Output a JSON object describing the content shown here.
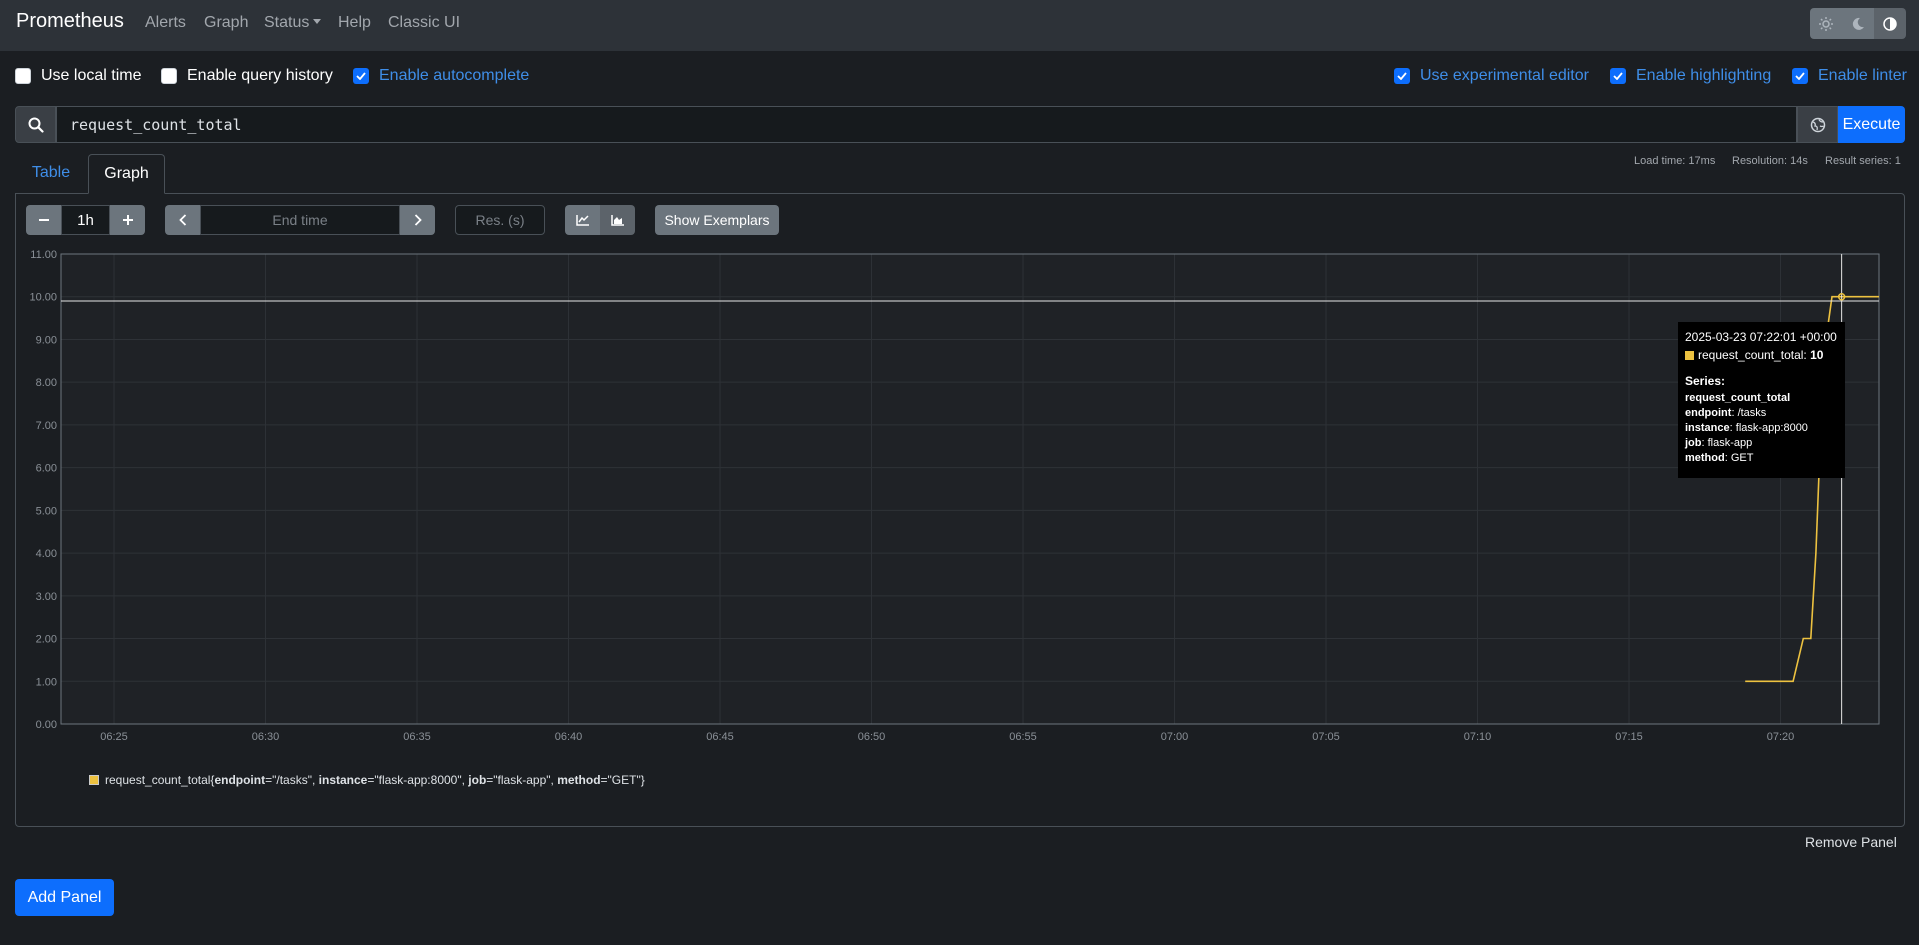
{
  "navbar": {
    "brand": "Prometheus",
    "links": [
      "Alerts",
      "Graph",
      "Status",
      "Help",
      "Classic UI"
    ],
    "theme_icons": [
      "sun-icon",
      "moon-icon",
      "adjust-icon"
    ]
  },
  "options": {
    "left": [
      {
        "label": "Use local time",
        "checked": false
      },
      {
        "label": "Enable query history",
        "checked": false
      },
      {
        "label": "Enable autocomplete",
        "checked": true
      }
    ],
    "right": [
      {
        "label": "Use experimental editor",
        "checked": true
      },
      {
        "label": "Enable highlighting",
        "checked": true
      },
      {
        "label": "Enable linter",
        "checked": true
      }
    ]
  },
  "query": {
    "expression": "request_count_total",
    "execute_label": "Execute"
  },
  "tabs": [
    "Table",
    "Graph"
  ],
  "stats": {
    "load_time": "Load time: 17ms",
    "resolution": "Resolution: 14s",
    "result_series": "Result series: 1"
  },
  "controls": {
    "range": "1h",
    "end_time_placeholder": "End time",
    "res_placeholder": "Res. (s)",
    "exemplars_label": "Show Exemplars"
  },
  "chart_data": {
    "type": "line",
    "ylim": [
      0,
      11
    ],
    "yticks": [
      "0.00",
      "1.00",
      "2.00",
      "3.00",
      "4.00",
      "5.00",
      "6.00",
      "7.00",
      "8.00",
      "9.00",
      "10.00",
      "11.00"
    ],
    "xticks": [
      "06:25",
      "06:30",
      "06:35",
      "06:40",
      "06:45",
      "06:50",
      "06:55",
      "07:00",
      "07:05",
      "07:10",
      "07:15",
      "07:20"
    ],
    "xlim": [
      "06:23:15",
      "07:23:15"
    ],
    "series": [
      {
        "name": "request_count_total",
        "color": "#edc240",
        "points": [
          [
            "07:18:50",
            1
          ],
          [
            "07:20:25",
            1
          ],
          [
            "07:20:45",
            2
          ],
          [
            "07:21:00",
            2
          ],
          [
            "07:21:10",
            4
          ],
          [
            "07:21:20",
            7
          ],
          [
            "07:21:30",
            9
          ],
          [
            "07:21:42",
            10
          ],
          [
            "07:23:15",
            10
          ]
        ]
      }
    ],
    "crosshair": {
      "x": "07:22:01",
      "y": 9.9
    }
  },
  "tooltip": {
    "time": "2025-03-23 07:22:01 +00:00",
    "value_label": "request_count_total:",
    "value": "10",
    "series_heading": "Series:",
    "metric": "request_count_total",
    "labels": [
      {
        "key": "endpoint",
        "value": "/tasks"
      },
      {
        "key": "instance",
        "value": "flask-app:8000"
      },
      {
        "key": "job",
        "value": "flask-app"
      },
      {
        "key": "method",
        "value": "GET"
      }
    ]
  },
  "legend": {
    "metric": "request_count_total",
    "open_brace": "{",
    "close_brace": "}",
    "labels": [
      {
        "key": "endpoint",
        "value": "\"/tasks\"",
        "sep": ", "
      },
      {
        "key": "instance",
        "value": "\"flask-app:8000\"",
        "sep": ", "
      },
      {
        "key": "job",
        "value": "\"flask-app\"",
        "sep": ", "
      },
      {
        "key": "method",
        "value": "\"GET\"",
        "sep": ""
      }
    ]
  },
  "remove_panel_label": "Remove Panel",
  "add_panel_label": "Add Panel"
}
